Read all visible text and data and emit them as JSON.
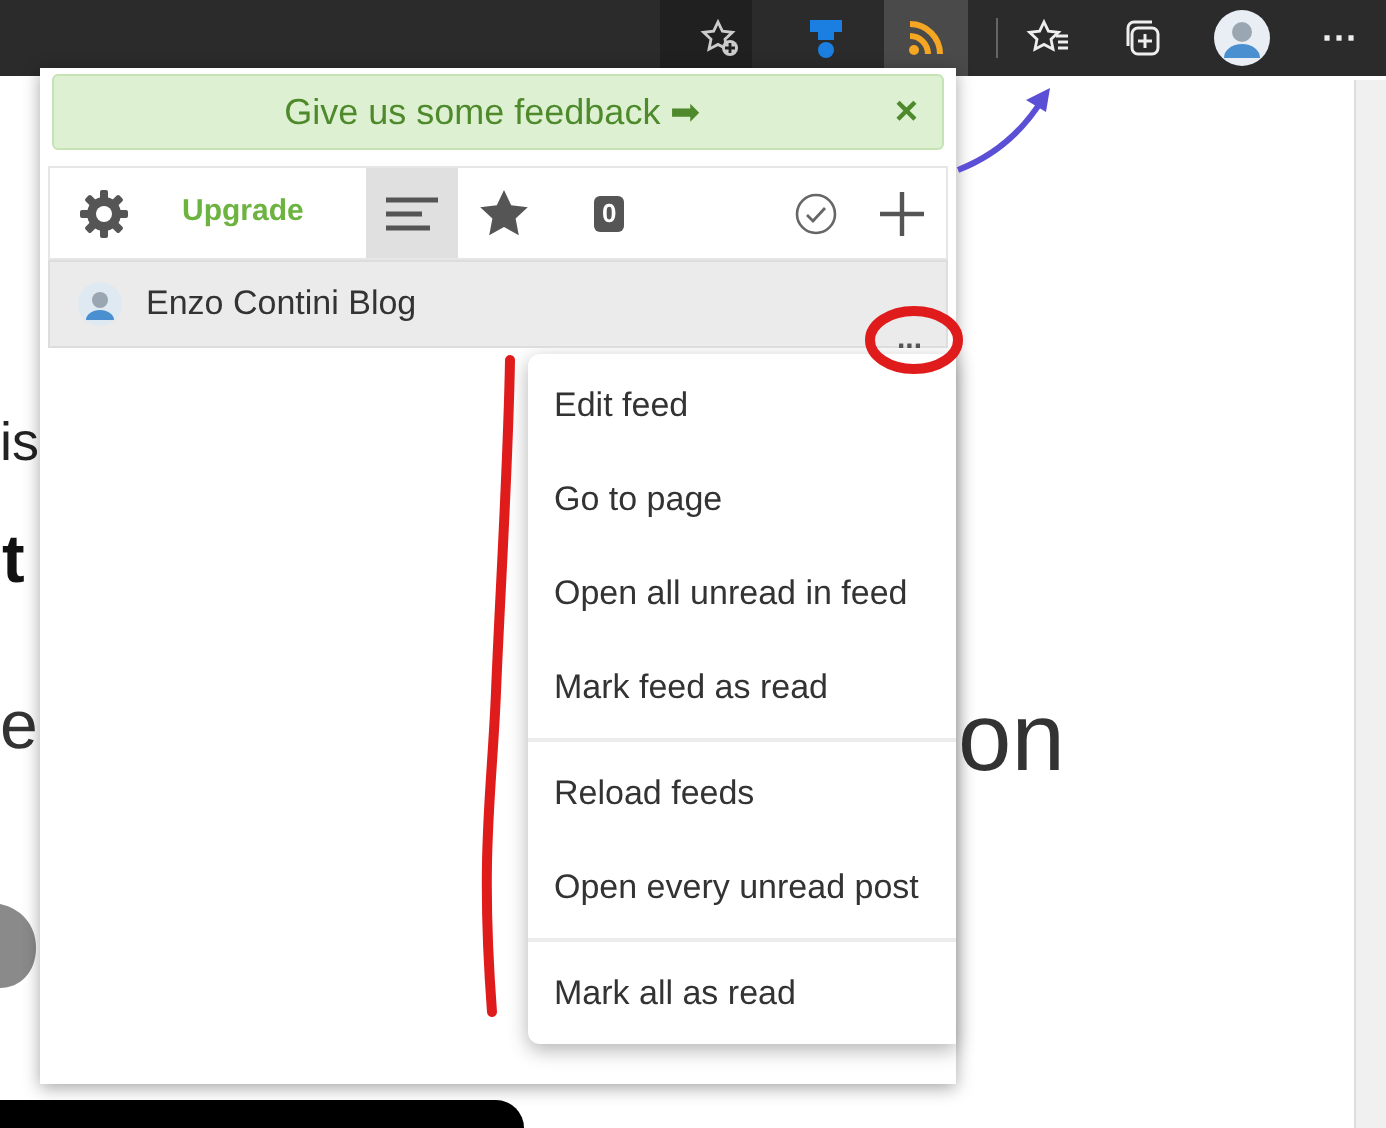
{
  "browser_toolbar": {
    "extensions": [
      {
        "kind": "generic",
        "selected": false
      },
      {
        "kind": "rss",
        "selected": true
      }
    ],
    "more_button": "···"
  },
  "feedback_banner": {
    "text": "Give us some feedback ➡",
    "close": "×"
  },
  "toolbar": {
    "upgrade": "Upgrade",
    "tabs": [
      {
        "kind": "feeds",
        "selected": true
      },
      {
        "kind": "starred",
        "selected": false
      }
    ],
    "count": "0"
  },
  "feed": {
    "name": "Enzo Contini Blog",
    "more": "..."
  },
  "menu": {
    "groups": [
      [
        "Edit feed",
        "Go to page",
        "Open all unread in feed",
        "Mark feed as read"
      ],
      [
        "Reload feeds",
        "Open every unread post"
      ],
      [
        "Mark all as read"
      ]
    ]
  },
  "background_page": {
    "fragments": [
      {
        "text": "is",
        "kind": "normal"
      },
      {
        "text": "t",
        "kind": "bold"
      },
      {
        "text": "e",
        "kind": "light"
      },
      {
        "text": "on",
        "kind": "light"
      }
    ]
  }
}
